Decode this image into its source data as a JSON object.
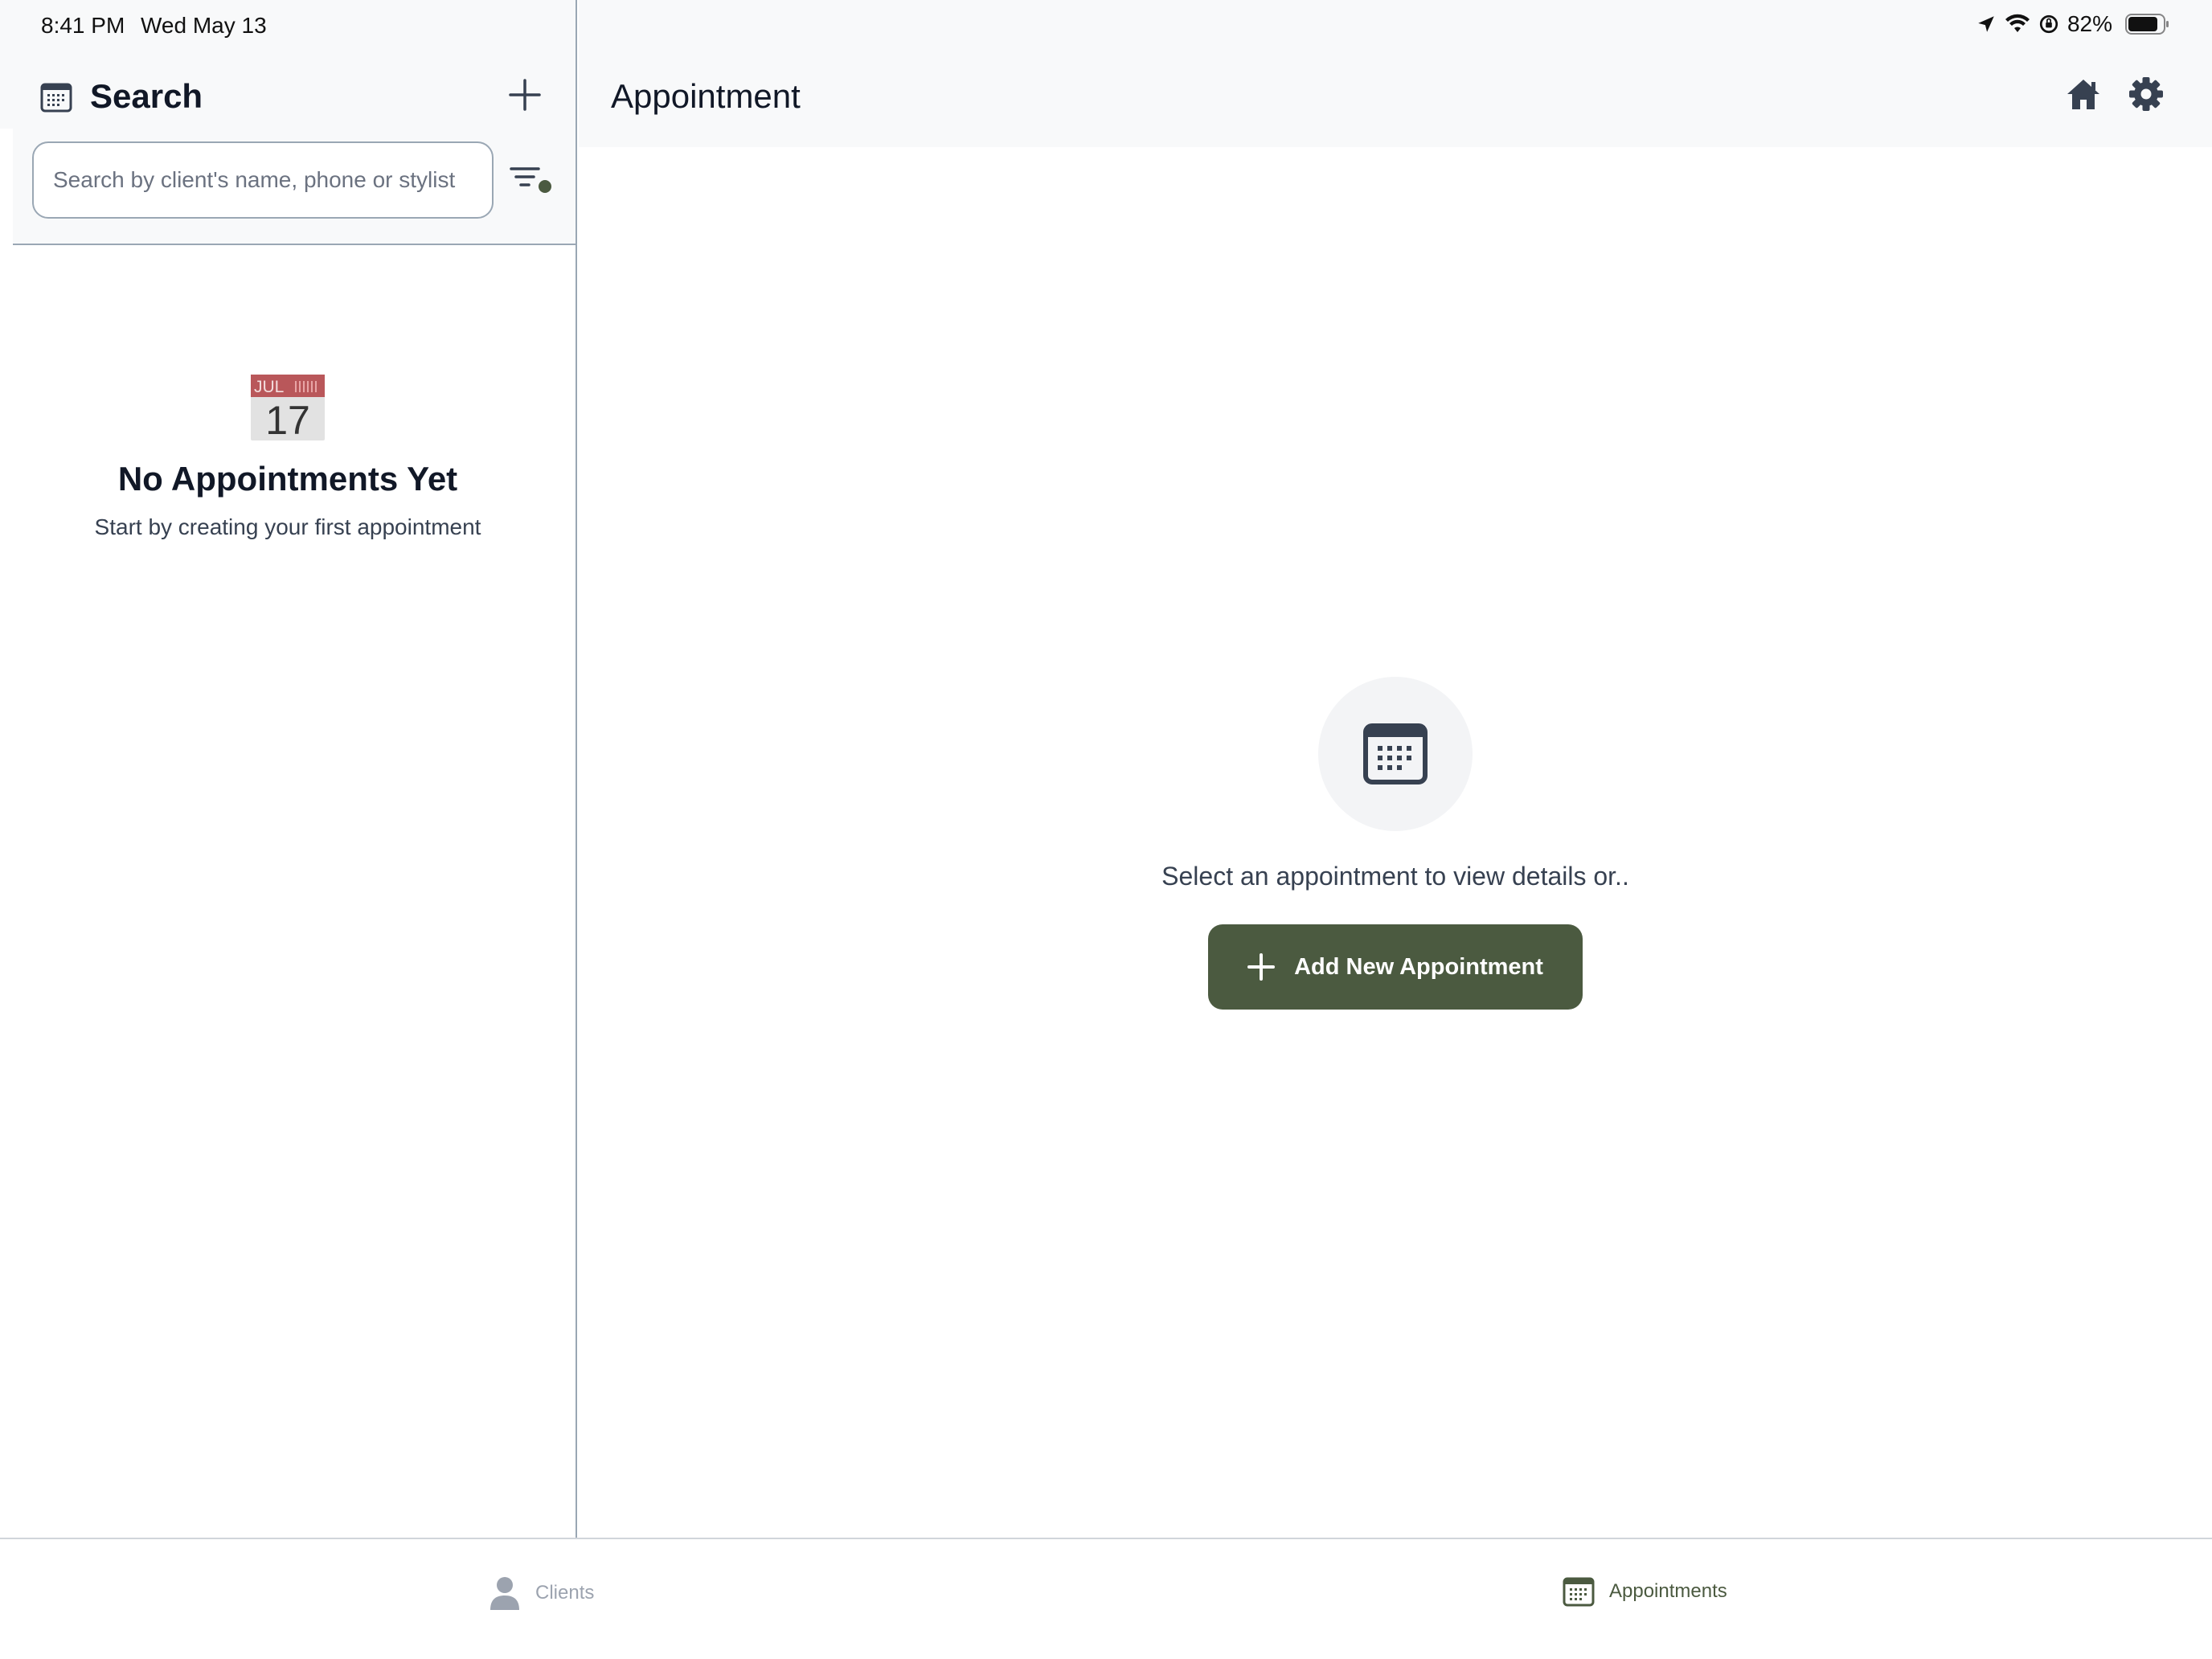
{
  "status_bar": {
    "time": "8:41 PM",
    "date": "Wed May 13",
    "battery": "82%"
  },
  "left_panel": {
    "title": "Search",
    "search": {
      "placeholder": "Search by client's name, phone or stylist",
      "value": ""
    },
    "calendar_emoji": {
      "month": "JUL",
      "day": "17"
    },
    "empty_title": "No Appointments Yet",
    "empty_subtitle": "Start by creating your first appointment"
  },
  "right_panel": {
    "title": "Appointment",
    "empty_text": "Select an appointment to view details or..",
    "add_button_label": "Add New Appointment"
  },
  "tabs": [
    {
      "label": "Clients",
      "active": false
    },
    {
      "label": "Appointments",
      "active": true
    }
  ],
  "colors": {
    "accent": "#4b5a40",
    "header_bg": "#f8f9fa",
    "divider": "#9aa7b4"
  }
}
